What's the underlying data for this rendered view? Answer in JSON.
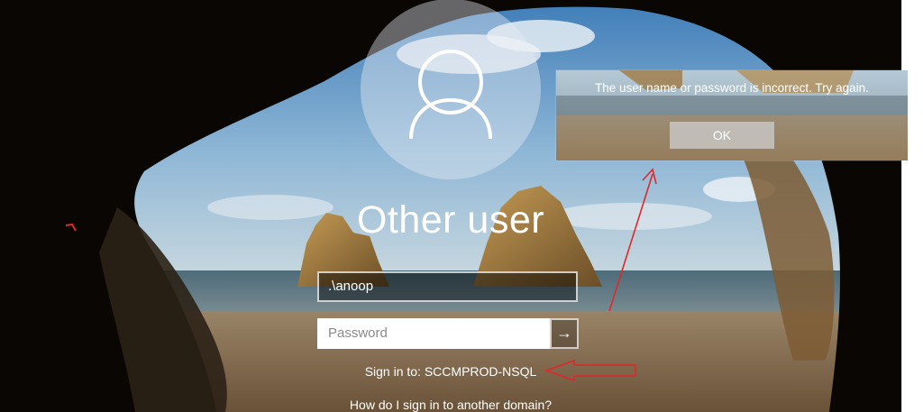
{
  "login": {
    "user_title": "Other user",
    "username_value": ".\\anoop",
    "password_placeholder": "Password",
    "submit_glyph": "→",
    "signin_prefix": "Sign in to:",
    "signin_domain": "SCCMPROD-NSQL",
    "other_domain_link": "How do I sign in to another domain?"
  },
  "dialog": {
    "message": "The user name or password is incorrect. Try again.",
    "ok_label": "OK"
  },
  "icons": {
    "avatar": "user-avatar-icon",
    "submit": "arrow-right-icon"
  },
  "colors": {
    "annotation_red": "#e0282a",
    "text_white": "#ffffff"
  }
}
